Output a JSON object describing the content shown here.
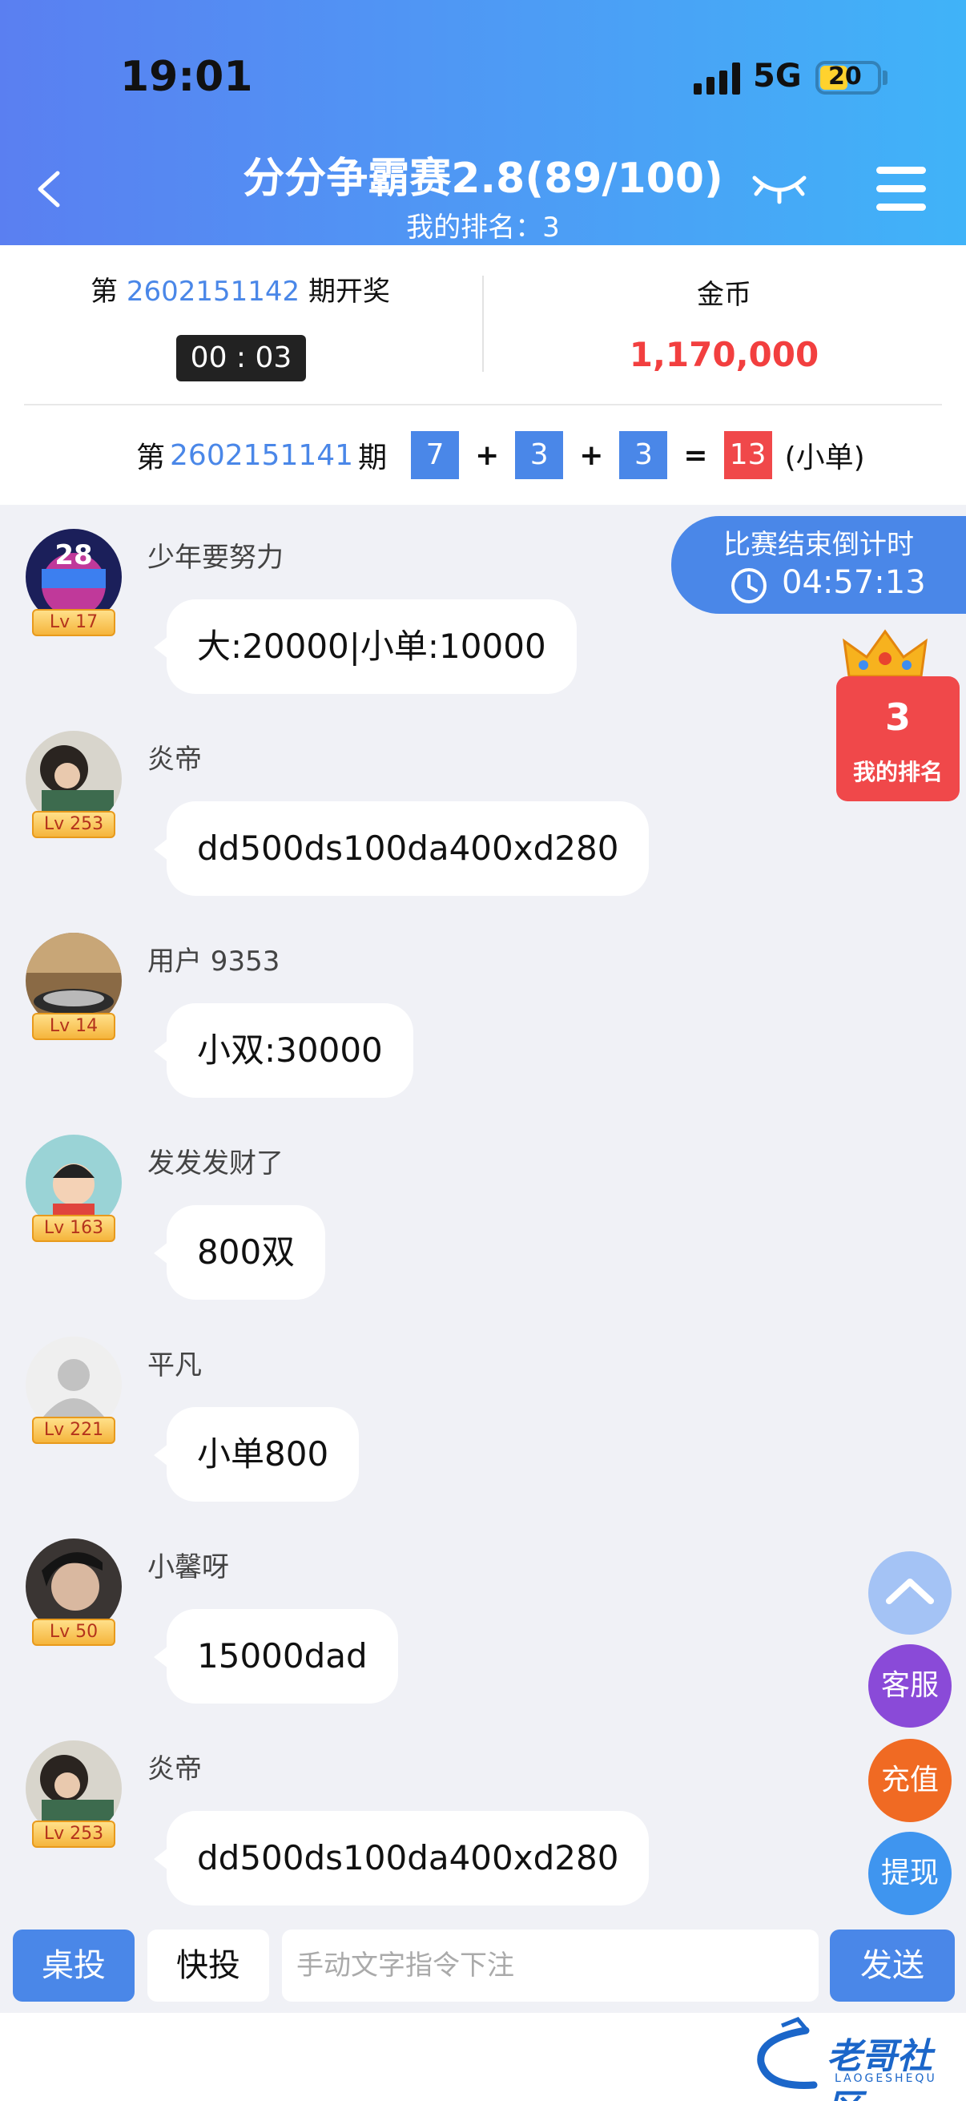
{
  "status_bar": {
    "time": "19:01",
    "network": "5G",
    "battery": "20"
  },
  "header": {
    "title": "分分争霸赛2.8(89/100)",
    "my_rank_line": "我的排名：3"
  },
  "draw": {
    "current_prefix": "第",
    "current_issue": "2602151142",
    "current_suffix": "期开奖",
    "countdown": "00 : 03",
    "coin_label": "金币",
    "coin_value": "1,170,000",
    "last_prefix": "第",
    "last_issue": "2602151141",
    "last_suffix": "期",
    "numbers": [
      "7",
      "3",
      "3"
    ],
    "plus": "+",
    "equals": "=",
    "sum": "13",
    "result_text": "(小单)"
  },
  "contest_timer": {
    "title": "比赛结束倒计时",
    "value": "04:57:13"
  },
  "rank_badge": {
    "rank": "3",
    "label": "我的排名"
  },
  "messages": [
    {
      "user": "少年要努力",
      "level": "Lv 17",
      "text": "大:20000|小单:10000"
    },
    {
      "user": "炎帝",
      "level": "Lv 253",
      "text": "dd500ds100da400xd280"
    },
    {
      "user": "用户 9353",
      "level": "Lv 14",
      "text": "小双:30000"
    },
    {
      "user": "发发发财了",
      "level": "Lv 163",
      "text": "800双"
    },
    {
      "user": "平凡",
      "level": "Lv 221",
      "text": "小单800"
    },
    {
      "user": "小馨呀",
      "level": "Lv 50",
      "text": "15000dad"
    },
    {
      "user": "炎帝",
      "level": "Lv 253",
      "text": "dd500ds100da400xd280"
    }
  ],
  "fabs": {
    "service": "客服",
    "recharge": "充值",
    "withdraw": "提现"
  },
  "bottom_bar": {
    "table_bet": "桌投",
    "quick_bet": "快投",
    "input_placeholder": "手动文字指令下注",
    "send": "发送"
  },
  "watermark": {
    "text": "老哥社区",
    "sub": "LAOGESHEQU"
  },
  "colors": {
    "accent": "#4a87e8",
    "red": "#f0484a",
    "coin": "#f23f3f"
  }
}
